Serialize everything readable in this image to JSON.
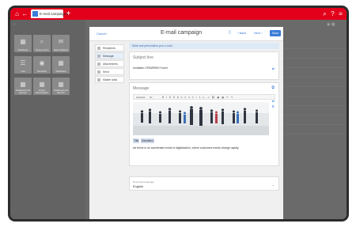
{
  "app": {
    "tab_label": "E-mail campaigns",
    "tiles": [
      {
        "label": "Dashboard",
        "icon": "dashboard-icon",
        "glyph": "▦"
      },
      {
        "label": "Survey search",
        "icon": "search-icon",
        "glyph": "⌕"
      },
      {
        "label": "Sales headlines",
        "icon": "megaphone-icon",
        "glyph": "✉"
      },
      {
        "label": "Lists",
        "icon": "list-icon",
        "glyph": "☰"
      },
      {
        "label": "Recording",
        "icon": "record-icon",
        "glyph": "◉"
      },
      {
        "label": "Dashboard",
        "icon": "dashboard-icon",
        "glyph": "▦"
      },
      {
        "label": "Dashboard and selection",
        "icon": "dashboard-icon",
        "glyph": "▦"
      },
      {
        "label": "Project administration",
        "icon": "project-icon",
        "glyph": "▦"
      },
      {
        "label": "Dashboard and selection",
        "icon": "dashboard-icon",
        "glyph": "▦"
      }
    ]
  },
  "dialog": {
    "cancel_label": "Cancel",
    "title": "E-mail campaign",
    "back_label": "Back",
    "next_label": "Next",
    "save_label": "Save",
    "steps": [
      "Recipients",
      "Message",
      "Attachments",
      "Send",
      "Master data"
    ],
    "active_step": 1,
    "info_text": "Write and personalize your e-mail.",
    "subject": {
      "title": "Subject line",
      "value": "Invitation CRM/ERM Forum"
    },
    "message": {
      "title": "Message",
      "font_label": "Verdana",
      "size_label": "10",
      "tags": [
        "Title",
        "Salutation"
      ],
      "body": "we thrive in an accelerated world of digitalization, where customers needs change rapidly."
    },
    "language": {
      "label": "Document language",
      "value": "English"
    }
  },
  "colors": {
    "brand_red": "#e2001a",
    "accent_blue": "#3b7dd8"
  }
}
